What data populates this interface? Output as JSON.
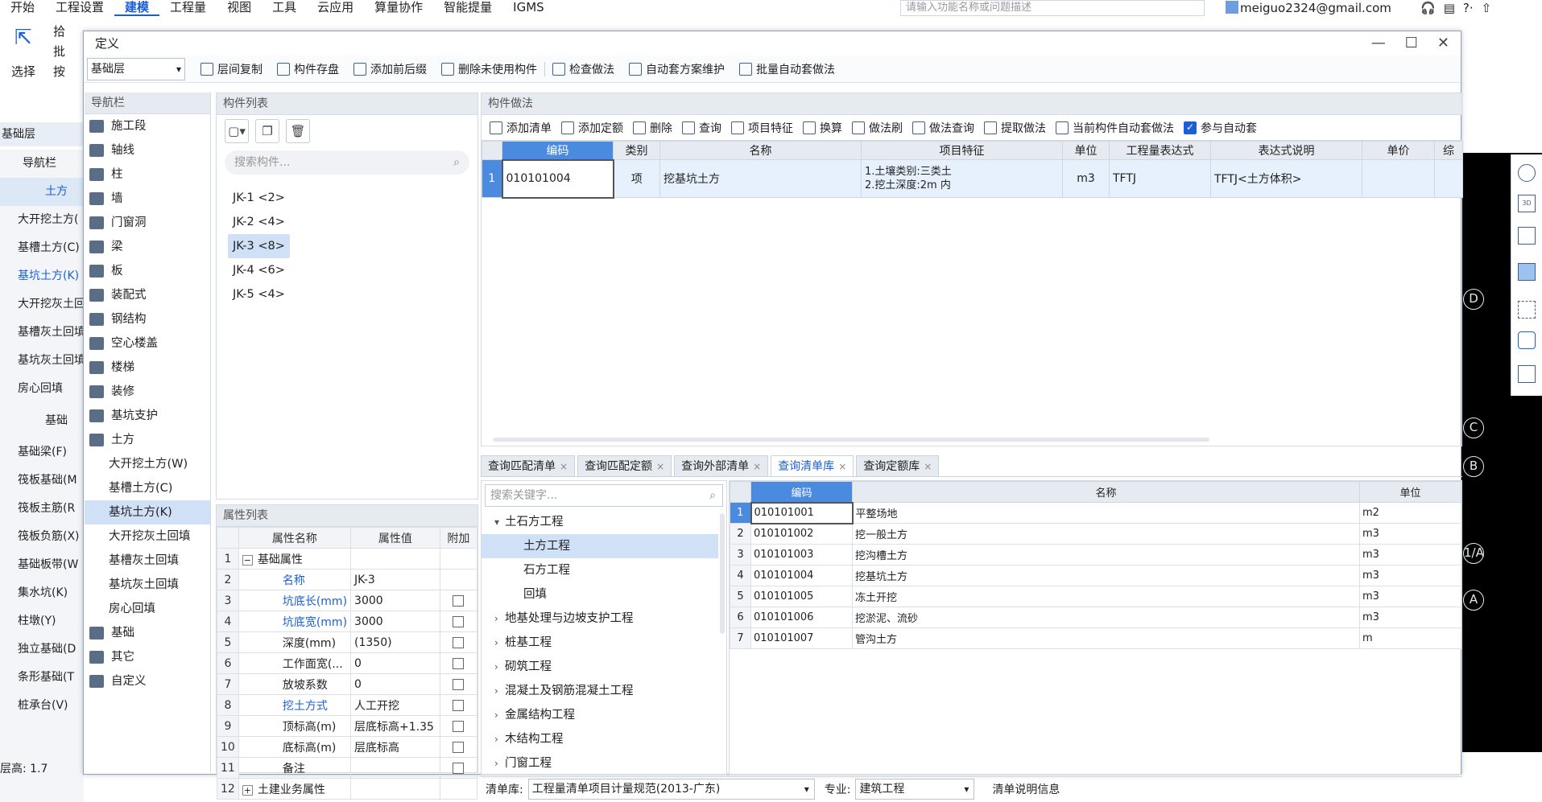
{
  "menu": [
    "开始",
    "工程设置",
    "建模",
    "工程量",
    "视图",
    "工具",
    "云应用",
    "算量协作",
    "智能提量",
    "IGMS"
  ],
  "menu_active_index": 2,
  "search_placeholder": "请输入功能名称或问题描述",
  "user": "meiguo2324@gmail.com",
  "win_tools": [
    "?·",
    "⇧"
  ],
  "ribbon": {
    "select_label": "选择",
    "items": [
      "拾",
      "批",
      "按"
    ]
  },
  "bg_left": {
    "header": "基础层",
    "nav_label": "导航栏",
    "group1": "土方",
    "items1": [
      "大开挖土方(",
      "基槽土方(C)",
      "基坑土方(K)",
      "大开挖灰土回",
      "基槽灰土回填",
      "基坑灰土回填",
      "房心回填"
    ],
    "group2": "基础",
    "items2": [
      "基础梁(F)",
      "筏板基础(M",
      "筏板主筋(R",
      "筏板负筋(X)",
      "基础板带(W",
      "集水坑(K)",
      "柱墩(Y)",
      "独立基础(D",
      "条形基础(T",
      "桩承台(V)"
    ],
    "floor_height": "层高:  1.7"
  },
  "axes": [
    "D",
    "C",
    "B",
    "1/A",
    "A"
  ],
  "dialog": {
    "title": "定义",
    "floor": "基础层",
    "toolbar": [
      "层间复制",
      "构件存盘",
      "添加前后缀",
      "删除未使用构件",
      "检查做法",
      "自动套方案维护",
      "批量自动套做法"
    ],
    "nav_title": "导航栏",
    "nav_items": [
      {
        "label": "施工段",
        "sub": false
      },
      {
        "label": "轴线",
        "sub": false
      },
      {
        "label": "柱",
        "sub": false
      },
      {
        "label": "墙",
        "sub": false
      },
      {
        "label": "门窗洞",
        "sub": false
      },
      {
        "label": "梁",
        "sub": false
      },
      {
        "label": "板",
        "sub": false
      },
      {
        "label": "装配式",
        "sub": false
      },
      {
        "label": "钢结构",
        "sub": false
      },
      {
        "label": "空心楼盖",
        "sub": false
      },
      {
        "label": "楼梯",
        "sub": false
      },
      {
        "label": "装修",
        "sub": false
      },
      {
        "label": "基坑支护",
        "sub": false
      },
      {
        "label": "土方",
        "sub": false
      },
      {
        "label": "大开挖土方(W)",
        "sub": true
      },
      {
        "label": "基槽土方(C)",
        "sub": true
      },
      {
        "label": "基坑土方(K)",
        "sub": true,
        "selected": true
      },
      {
        "label": "大开挖灰土回填",
        "sub": true
      },
      {
        "label": "基槽灰土回填",
        "sub": true
      },
      {
        "label": "基坑灰土回填",
        "sub": true
      },
      {
        "label": "房心回填",
        "sub": true
      },
      {
        "label": "基础",
        "sub": false
      },
      {
        "label": "其它",
        "sub": false
      },
      {
        "label": "自定义",
        "sub": false
      }
    ],
    "comp_title": "构件列表",
    "comp_search": "搜索构件...",
    "components": [
      "JK-1 <2>",
      "JK-2 <4>",
      "JK-3 <8>",
      "JK-4 <6>",
      "JK-5 <4>"
    ],
    "comp_selected": 2,
    "attr_title": "属性列表",
    "attr_headers": [
      "属性名称",
      "属性值",
      "附加"
    ],
    "attrs": [
      {
        "n": "1",
        "name": "基础属性",
        "value": "",
        "blue": false,
        "group": true,
        "cb": false,
        "sign": "−"
      },
      {
        "n": "2",
        "name": "名称",
        "value": "JK-3",
        "blue": true,
        "cb": false
      },
      {
        "n": "3",
        "name": "坑底长(mm)",
        "value": "3000",
        "blue": true,
        "cb": true
      },
      {
        "n": "4",
        "name": "坑底宽(mm)",
        "value": "3000",
        "blue": true,
        "cb": true
      },
      {
        "n": "5",
        "name": "深度(mm)",
        "value": "(1350)",
        "blue": false,
        "cb": true
      },
      {
        "n": "6",
        "name": "工作面宽(...",
        "value": "0",
        "blue": false,
        "cb": true
      },
      {
        "n": "7",
        "name": "放坡系数",
        "value": "0",
        "blue": false,
        "cb": true
      },
      {
        "n": "8",
        "name": "挖土方式",
        "value": "人工开挖",
        "blue": true,
        "cb": true
      },
      {
        "n": "9",
        "name": "顶标高(m)",
        "value": "层底标高+1.35",
        "blue": false,
        "cb": true
      },
      {
        "n": "10",
        "name": "底标高(m)",
        "value": "层底标高",
        "blue": false,
        "cb": true
      },
      {
        "n": "11",
        "name": "备注",
        "value": "",
        "blue": false,
        "cb": true
      },
      {
        "n": "12",
        "name": "土建业务属性",
        "value": "",
        "blue": false,
        "group": true,
        "cb": false,
        "sign": "+"
      }
    ],
    "method_title": "构件做法",
    "method_toolbar": [
      "添加清单",
      "添加定额",
      "删除",
      "查询",
      "项目特征",
      "换算",
      "做法刷",
      "做法查询",
      "提取做法",
      "当前构件自动套做法",
      "参与自动套"
    ],
    "method_headers": [
      "编码",
      "类别",
      "名称",
      "项目特征",
      "单位",
      "工程量表达式",
      "表达式说明",
      "单价",
      "综"
    ],
    "method_rows": [
      {
        "idx": "1",
        "code": "010101004",
        "type": "项",
        "name": "挖基坑土方",
        "feature1": "1.土壤类别:三类土",
        "feature2": "2.挖土深度:2m 内",
        "unit": "m3",
        "expr": "TFTJ",
        "desc": "TFTJ<土方体积>",
        "price": ""
      }
    ],
    "tabs": [
      "查询匹配清单",
      "查询匹配定额",
      "查询外部清单",
      "查询清单库",
      "查询定额库"
    ],
    "tab_active": 3,
    "tree_search": "搜索关键字...",
    "tree": [
      {
        "label": "土石方工程",
        "level": 0,
        "sign": "▾"
      },
      {
        "label": "土方工程",
        "level": 1,
        "selected": true
      },
      {
        "label": "石方工程",
        "level": 1
      },
      {
        "label": "回填",
        "level": 1
      },
      {
        "label": "地基处理与边坡支护工程",
        "level": 0,
        "sign": "›"
      },
      {
        "label": "桩基工程",
        "level": 0,
        "sign": "›"
      },
      {
        "label": "砌筑工程",
        "level": 0,
        "sign": "›"
      },
      {
        "label": "混凝土及钢筋混凝土工程",
        "level": 0,
        "sign": "›"
      },
      {
        "label": "金属结构工程",
        "level": 0,
        "sign": "›"
      },
      {
        "label": "木结构工程",
        "level": 0,
        "sign": "›"
      },
      {
        "label": "门窗工程",
        "level": 0,
        "sign": "›"
      }
    ],
    "lib_headers": [
      "编码",
      "名称",
      "单位"
    ],
    "lib_rows": [
      {
        "idx": "1",
        "code": "010101001",
        "name": "平整场地",
        "unit": "m2"
      },
      {
        "idx": "2",
        "code": "010101002",
        "name": "挖一般土方",
        "unit": "m3"
      },
      {
        "idx": "3",
        "code": "010101003",
        "name": "挖沟槽土方",
        "unit": "m3"
      },
      {
        "idx": "4",
        "code": "010101004",
        "name": "挖基坑土方",
        "unit": "m3"
      },
      {
        "idx": "5",
        "code": "010101005",
        "name": "冻土开挖",
        "unit": "m3"
      },
      {
        "idx": "6",
        "code": "010101006",
        "name": "挖淤泥、流砂",
        "unit": "m3"
      },
      {
        "idx": "7",
        "code": "010101007",
        "name": "管沟土方",
        "unit": "m"
      }
    ],
    "bottom": {
      "lib_label": "清单库:",
      "lib_value": "工程量清单项目计量规范(2013-广东)",
      "spec_label": "专业:",
      "spec_value": "建筑工程",
      "info": "清单说明信息"
    }
  }
}
